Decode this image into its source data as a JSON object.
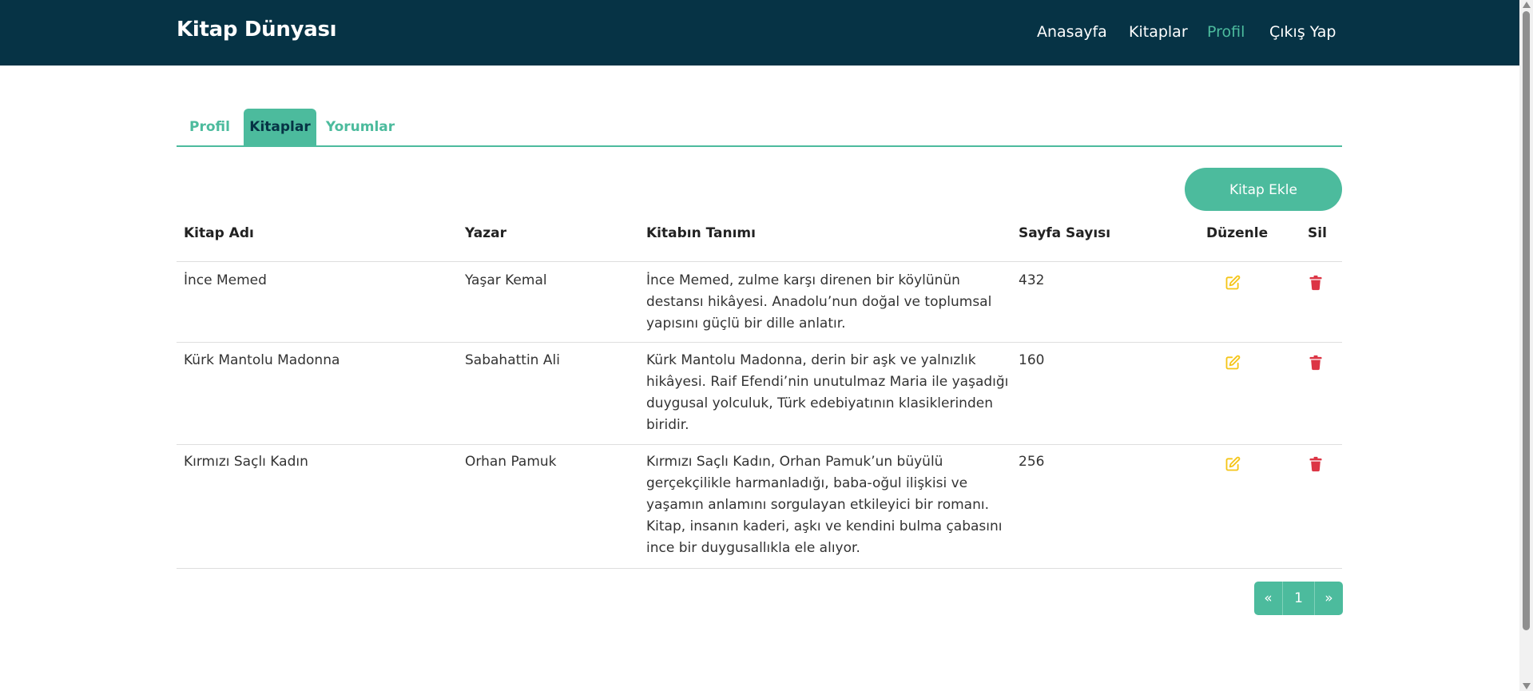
{
  "navbar": {
    "brand": "Kitap Dünyası",
    "links": [
      {
        "label": "Anasayfa",
        "active": false
      },
      {
        "label": "Kitaplar",
        "active": false
      },
      {
        "label": "Profil",
        "active": true
      },
      {
        "label": "Çıkış Yap",
        "active": false
      }
    ]
  },
  "tabs": [
    {
      "label": "Profil",
      "active": false
    },
    {
      "label": "Kitaplar",
      "active": true
    },
    {
      "label": "Yorumlar",
      "active": false
    }
  ],
  "add_button_label": "Kitap Ekle",
  "table": {
    "headers": [
      "Kitap Adı",
      "Yazar",
      "Kitabın Tanımı",
      "Sayfa Sayısı",
      "Düzenle",
      "Sil"
    ],
    "rows": [
      {
        "title": "İnce Memed",
        "author": "Yaşar Kemal",
        "description_lines": [
          "İnce Memed, zulme karşı direnen bir köylünün",
          "destansı hikâyesi. Anadolu’nun doğal ve toplumsal",
          "yapısını güçlü bir dille anlatır."
        ],
        "pages": "432",
        "edit_icon": "edit-icon",
        "delete_icon": "trash-icon"
      },
      {
        "title": "Kürk Mantolu Madonna",
        "author": "Sabahattin Ali",
        "description_lines": [
          "Kürk Mantolu Madonna, derin bir aşk ve yalnızlık",
          "hikâyesi. Raif Efendi’nin unutulmaz Maria ile yaşadığı",
          "duygusal yolculuk, Türk edebiyatının klasiklerinden",
          "biridir."
        ],
        "pages": "160",
        "edit_icon": "edit-icon",
        "delete_icon": "trash-icon"
      },
      {
        "title": "Kırmızı Saçlı Kadın",
        "author": "Orhan Pamuk",
        "description_lines": [
          "Kırmızı Saçlı Kadın, Orhan Pamuk’un büyülü",
          "gerçekçilikle harmanladığı, baba-oğul ilişkisi ve",
          "yaşamın anlamını sorgulayan etkileyici bir romanı.",
          "Kitap, insanın kaderi, aşkı ve kendini bulma çabasını",
          "ince bir duygusallıkla ele alıyor."
        ],
        "pages": "256",
        "edit_icon": "edit-icon",
        "delete_icon": "trash-icon"
      }
    ]
  },
  "pagination": [
    "«",
    "1",
    "»"
  ],
  "colors": {
    "navbar_bg": "#063345",
    "accent": "#4cbb9d",
    "edit_icon": "#f5c518",
    "delete_icon": "#dc3545"
  }
}
